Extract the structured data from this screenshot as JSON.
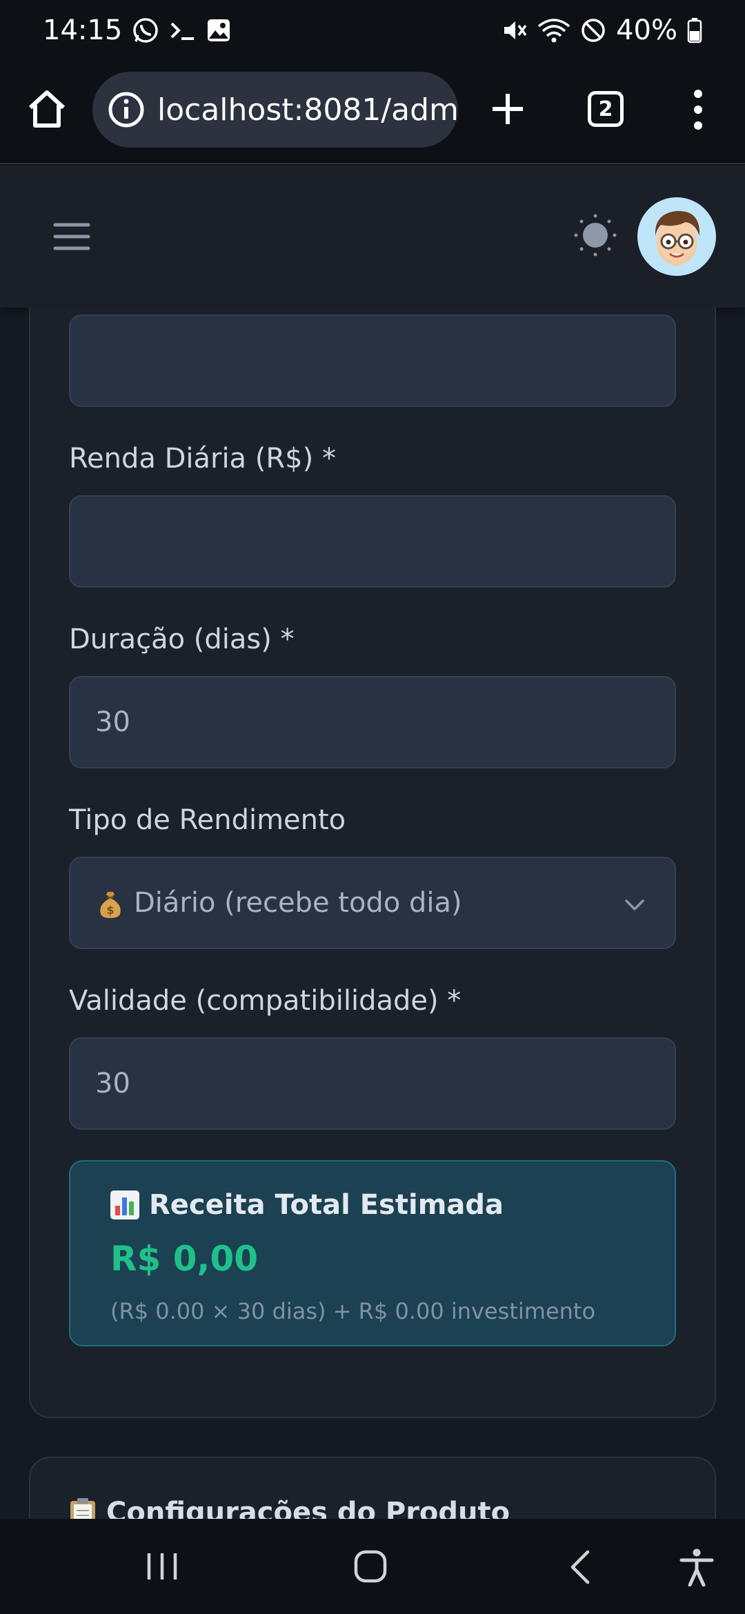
{
  "status_bar": {
    "time": "14:15",
    "battery": "40%",
    "left_icons": [
      "whatsapp-icon",
      "terminal-icon",
      "gallery-icon"
    ],
    "right_icons": [
      "mute-icon",
      "wifi-icon",
      "do-not-disturb-icon",
      "battery-icon"
    ]
  },
  "browser": {
    "url": "localhost:8081/adm",
    "tab_count": "2"
  },
  "form": {
    "daily_income_label": "Renda Diária (R$) *",
    "daily_income_value": "",
    "duration_label": "Duração (dias) *",
    "duration_value": "30",
    "yield_type_label": "Tipo de Rendimento",
    "yield_type_value": "Diário (recebe todo dia)",
    "yield_type_icon": "money-bag-icon",
    "validity_label": "Validade (compatibilidade) *",
    "validity_value": "30"
  },
  "estimate": {
    "title": "Receita Total Estimada",
    "title_icon": "bar-chart-icon",
    "value": "R$ 0,00",
    "formula": "(R$ 0.00 × 30 dias) + R$ 0.00 investimento",
    "value_color": "#1fc08a"
  },
  "product_settings": {
    "title": "Configurações do Produto",
    "title_icon": "clipboard-icon"
  },
  "colors": {
    "background": "#151a22",
    "card": "#1b212b",
    "input": "#283242",
    "estimate_bg": "#1b4152",
    "estimate_border": "#1f6f7a"
  }
}
